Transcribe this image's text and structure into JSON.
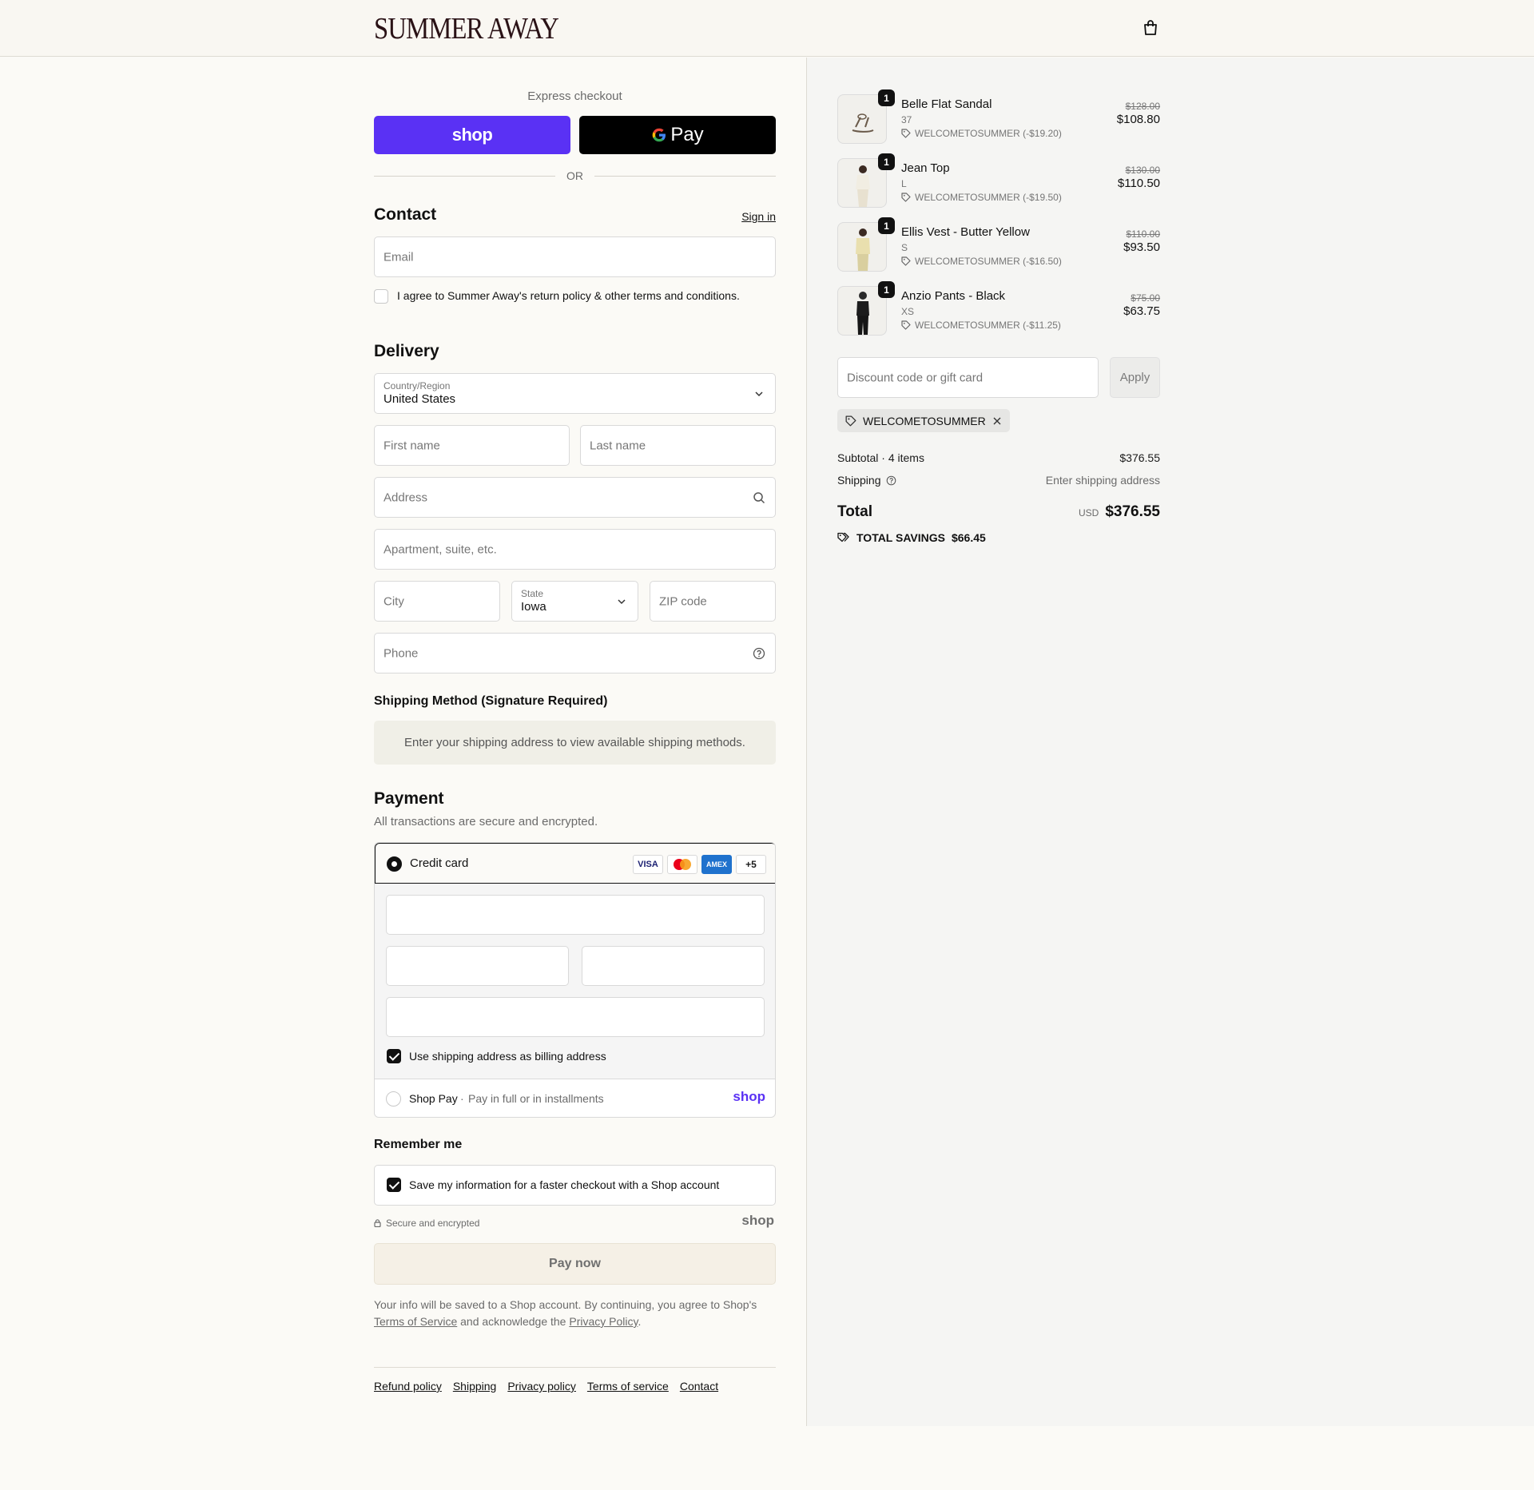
{
  "brand": {
    "name": "SUMMER AWAY"
  },
  "express": {
    "label": "Express checkout",
    "shop_pay_label": "shop",
    "gpay_label": "Pay",
    "or_label": "OR"
  },
  "contact": {
    "title": "Contact",
    "sign_in": "Sign in",
    "email_placeholder": "Email",
    "agree_text": "I agree to Summer Away's return policy & other terms and conditions."
  },
  "delivery": {
    "title": "Delivery",
    "country_label": "Country/Region",
    "country_value": "United States",
    "first_name_placeholder": "First name",
    "last_name_placeholder": "Last name",
    "address_placeholder": "Address",
    "apartment_placeholder": "Apartment, suite, etc.",
    "city_placeholder": "City",
    "state_label": "State",
    "state_value": "Iowa",
    "zip_placeholder": "ZIP code",
    "phone_placeholder": "Phone"
  },
  "shipping_method": {
    "title": "Shipping Method (Signature Required)",
    "note": "Enter your shipping address to view available shipping methods."
  },
  "payment": {
    "title": "Payment",
    "subtitle": "All transactions are secure and encrypted.",
    "credit_card_label": "Credit card",
    "cards": [
      "VISA",
      "MC",
      "AMEX"
    ],
    "more_cards": "+5",
    "billing_same_label": "Use shipping address as billing address",
    "shop_pay_label": "Shop Pay",
    "shop_pay_desc": "Pay in full or in installments",
    "shop_pay_logo": "shop"
  },
  "remember": {
    "title": "Remember me",
    "save_label": "Save my information for a faster checkout with a Shop account",
    "secure_label": "Secure and encrypted",
    "shop_logo": "shop"
  },
  "pay_now": "Pay now",
  "legal": {
    "text1": "Your info will be saved to a Shop account. By continuing, you agree to Shop's",
    "terms_link": "Terms of Service",
    "text2": "and acknowledge the",
    "privacy_link": "Privacy Policy",
    "text3": "."
  },
  "footer": {
    "links": [
      "Refund policy",
      "Shipping",
      "Privacy policy",
      "Terms of service",
      "Contact"
    ]
  },
  "cart": {
    "items": [
      {
        "qty": "1",
        "name": "Belle Flat Sandal",
        "variant": "37",
        "discount": "WELCOMETOSUMMER (-$19.20)",
        "old_price": "$128.00",
        "price": "$108.80"
      },
      {
        "qty": "1",
        "name": "Jean Top",
        "variant": "L",
        "discount": "WELCOMETOSUMMER (-$19.50)",
        "old_price": "$130.00",
        "price": "$110.50"
      },
      {
        "qty": "1",
        "name": "Ellis Vest - Butter Yellow",
        "variant": "S",
        "discount": "WELCOMETOSUMMER (-$16.50)",
        "old_price": "$110.00",
        "price": "$93.50"
      },
      {
        "qty": "1",
        "name": "Anzio Pants - Black",
        "variant": "XS",
        "discount": "WELCOMETOSUMMER (-$11.25)",
        "old_price": "$75.00",
        "price": "$63.75"
      }
    ],
    "discount_placeholder": "Discount code or gift card",
    "apply_label": "Apply",
    "applied_code": "WELCOMETOSUMMER",
    "subtotal_label": "Subtotal · 4 items",
    "subtotal_value": "$376.55",
    "shipping_label": "Shipping",
    "shipping_value": "Enter shipping address",
    "total_label": "Total",
    "currency": "USD",
    "total_value": "$376.55",
    "savings_label": "TOTAL SAVINGS",
    "savings_value": "$66.45"
  },
  "colors": {
    "shop_purple": "#5a31f4",
    "accent_dark": "#111111",
    "background": "#fbfaf6"
  }
}
